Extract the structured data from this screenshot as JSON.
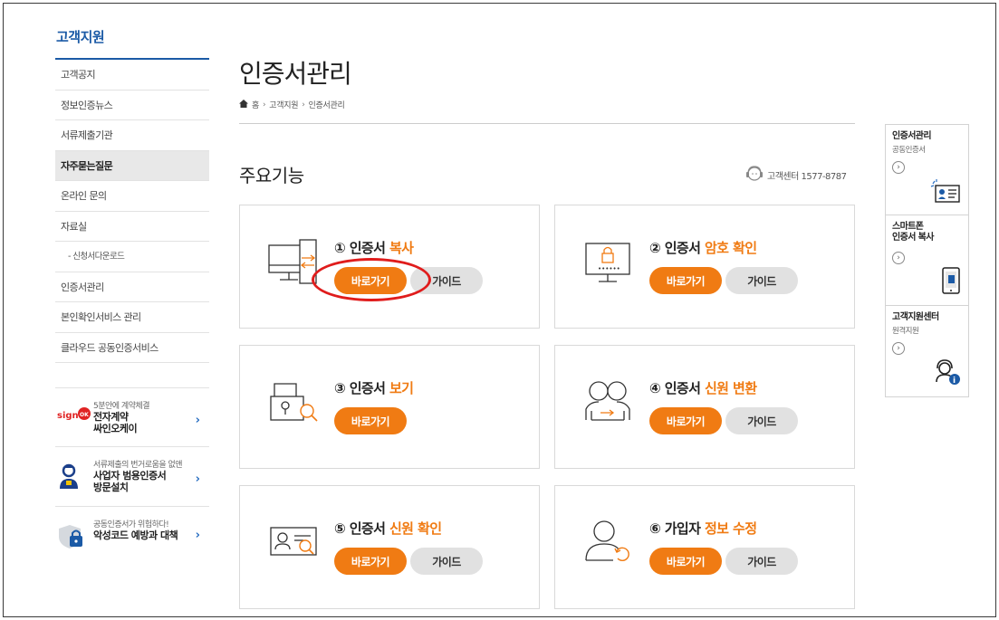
{
  "sidebar": {
    "title": "고객지원",
    "items": [
      {
        "label": "고객공지"
      },
      {
        "label": "정보인증뉴스"
      },
      {
        "label": "서류제출기관"
      },
      {
        "label": "자주묻는질문"
      },
      {
        "label": "온라인 문의"
      },
      {
        "label": "자료실"
      },
      {
        "label": "- 신청서다운로드"
      },
      {
        "label": "인증서관리"
      },
      {
        "label": "본인확인서비스 관리"
      },
      {
        "label": "클라우드 공동인증서비스"
      }
    ],
    "active_index": 3,
    "promos": [
      {
        "small": "5분안에 계약체결",
        "line1": "전자계약",
        "line2": "싸인오케이",
        "logo": "signOK"
      },
      {
        "small": "서류제출의 번거로움을 없앤",
        "line1": "사업자 범용인증서",
        "line2": "방문설치"
      },
      {
        "small": "공동인증서가 위험하다!",
        "line1": "악성코드 예방과 대책",
        "line2": ""
      }
    ]
  },
  "page": {
    "title": "인증서관리",
    "breadcrumb": {
      "home": "홈",
      "level1": "고객지원",
      "level2": "인증서관리"
    },
    "section_title": "주요기능",
    "customer_center": "고객센터 1577-8787"
  },
  "cards": [
    {
      "num": "①",
      "prefix": "인증서",
      "highlight": "복사",
      "go": "바로가기",
      "guide": "가이드",
      "icon": "copy-monitor-icon"
    },
    {
      "num": "②",
      "prefix": "인증서",
      "highlight": "암호 확인",
      "go": "바로가기",
      "guide": "가이드",
      "icon": "lock-monitor-icon"
    },
    {
      "num": "③",
      "prefix": "인증서",
      "highlight": "보기",
      "go": "바로가기",
      "guide": "",
      "icon": "cert-search-icon"
    },
    {
      "num": "④",
      "prefix": "인증서",
      "highlight": "신원 변환",
      "go": "바로가기",
      "guide": "가이드",
      "icon": "identity-transfer-icon"
    },
    {
      "num": "⑤",
      "prefix": "인증서",
      "highlight": "신원 확인",
      "go": "바로가기",
      "guide": "가이드",
      "icon": "id-card-search-icon"
    },
    {
      "num": "⑥",
      "prefix": "가입자",
      "highlight": "정보 수정",
      "go": "바로가기",
      "guide": "가이드",
      "icon": "user-refresh-icon"
    }
  ],
  "quick_menu": [
    {
      "title": "인증서관리",
      "sub": "공동인증서",
      "icon": "id-card-icon"
    },
    {
      "title": "스마트폰 인증서 복사",
      "title_line1": "스마트폰",
      "title_line2": "인증서 복사",
      "sub": "",
      "icon": "smartphone-icon"
    },
    {
      "title": "고객지원센터",
      "sub": "원격지원",
      "icon": "headset-agent-icon"
    }
  ],
  "colors": {
    "accent": "#f07b13",
    "brand": "#1b5aa6",
    "annotation": "#e01c1c"
  }
}
